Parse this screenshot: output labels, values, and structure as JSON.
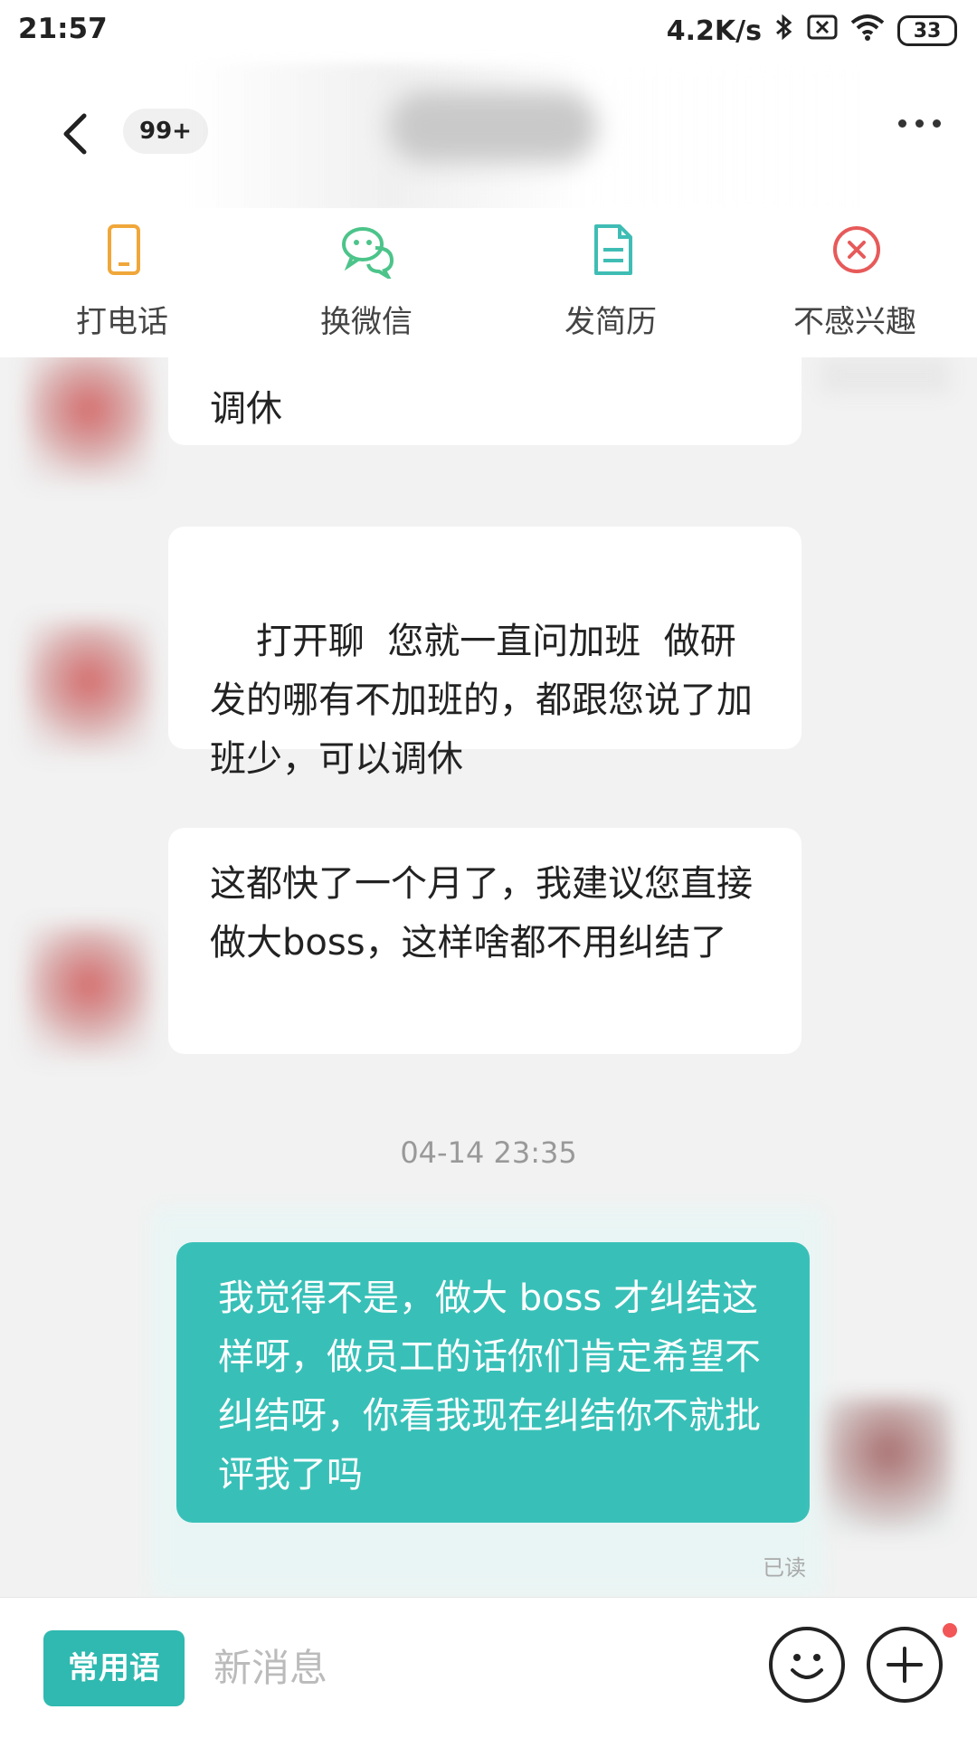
{
  "status": {
    "time": "21:57",
    "speed": "4.2K/s",
    "battery": "33"
  },
  "header": {
    "unread": "99+"
  },
  "actions": [
    {
      "label": "打电话",
      "icon": "phone-icon",
      "color": "#f0a73a"
    },
    {
      "label": "换微信",
      "icon": "wechat-icon",
      "color": "#4cc48a"
    },
    {
      "label": "发简历",
      "icon": "resume-icon",
      "color": "#3fbdb5"
    },
    {
      "label": "不感兴趣",
      "icon": "close-circle-icon",
      "color": "#e75a5a"
    }
  ],
  "messages": {
    "m1": "调休",
    "m2": "打开聊  您就一直问加班  做研发的哪有不加班的，都跟您说了加班少，可以调休",
    "m3": "这都快了一个月了，我建议您直接做大boss，这样啥都不用纠结了",
    "timestamp": "04-14 23:35",
    "m4": "我觉得不是，做大 boss 才纠结这样呀，做员工的话你们肯定希望不纠结呀，你看我现在纠结你不就批评我了吗",
    "read": "已读"
  },
  "bottom": {
    "phrase_label": "常用语",
    "placeholder": "新消息"
  },
  "colors": {
    "accent": "#2fb9b0",
    "my_bubble": "#38c0b8"
  }
}
